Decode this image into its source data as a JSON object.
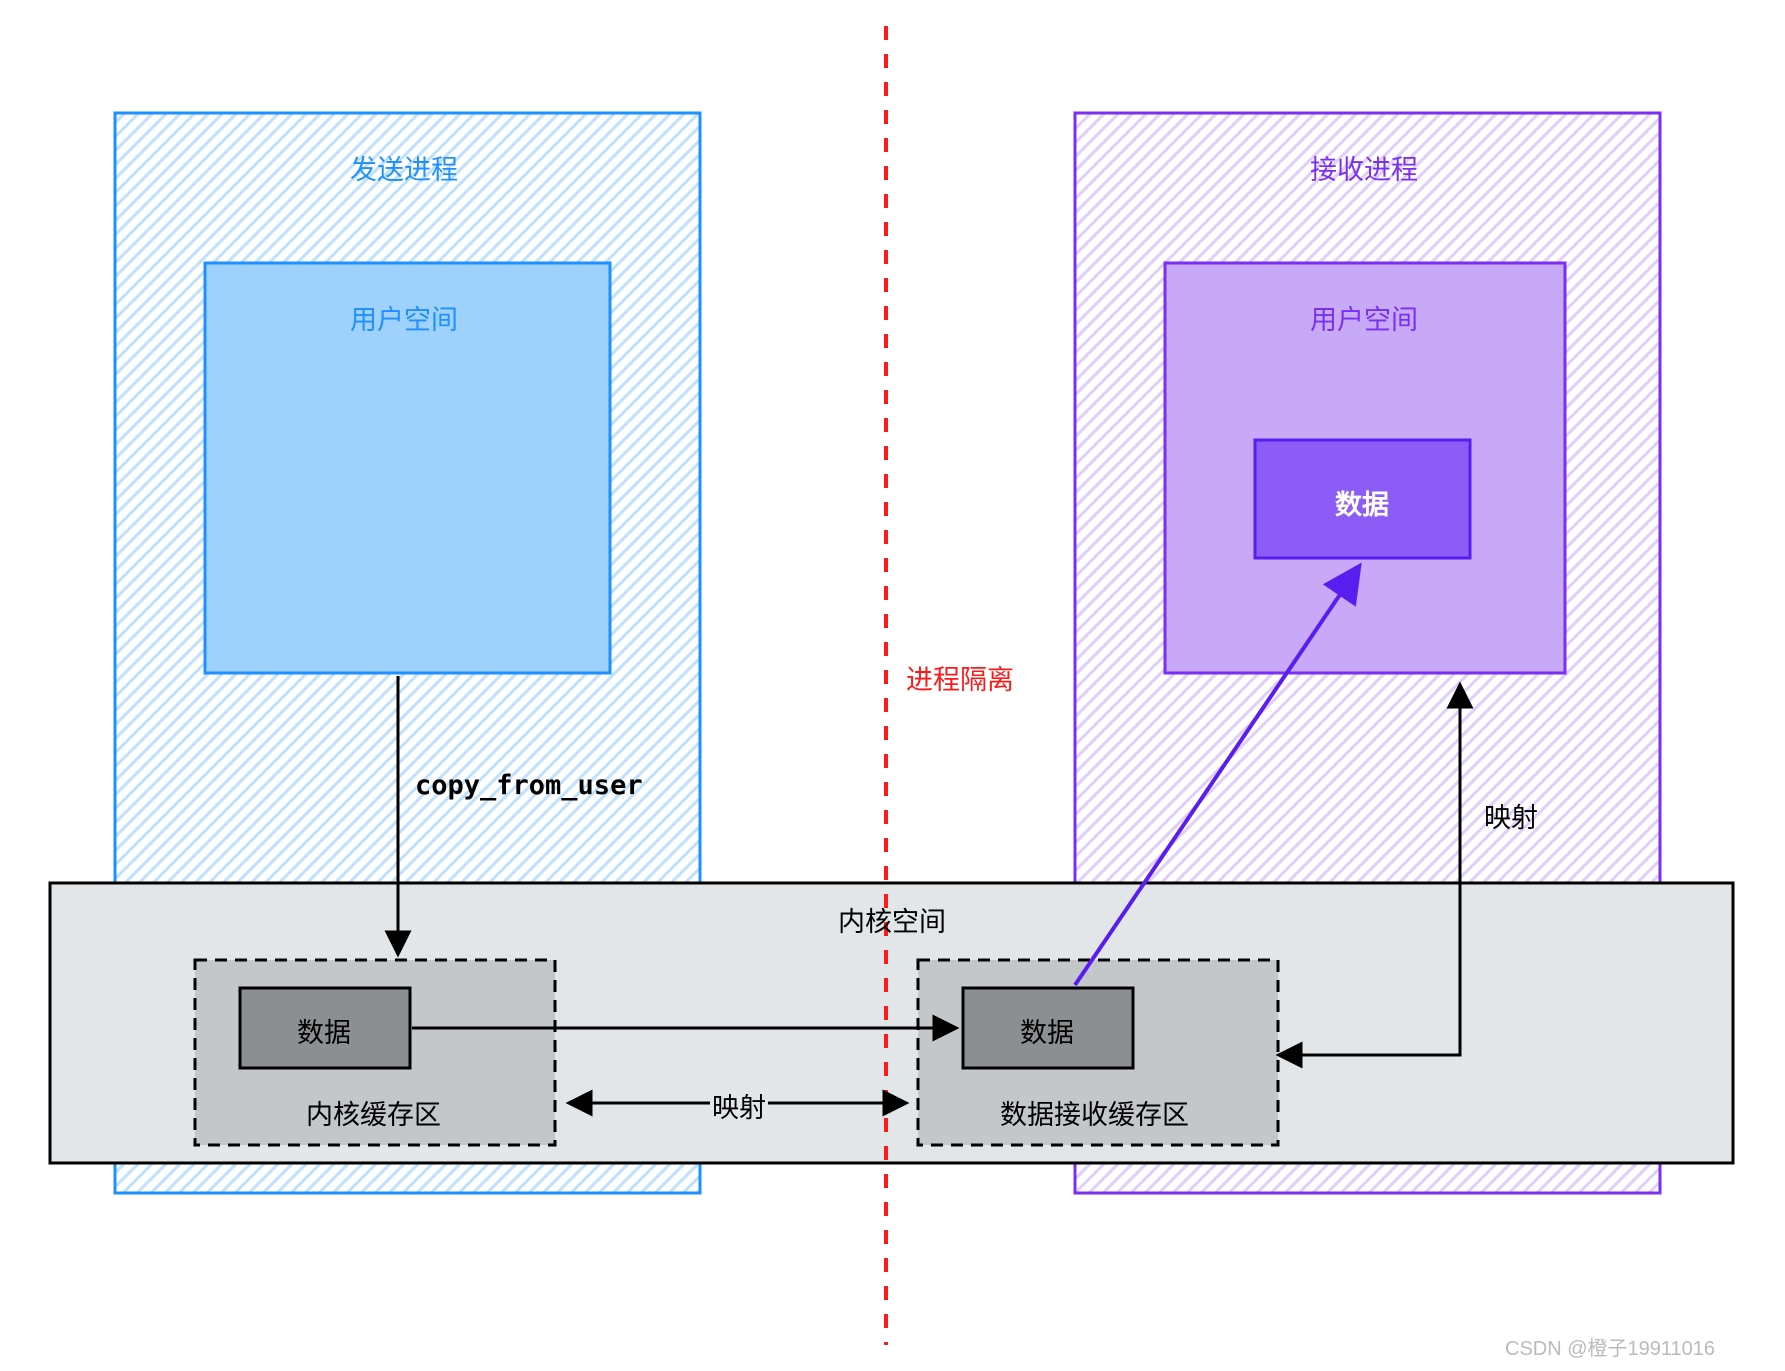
{
  "sender": {
    "title": "发送进程",
    "user_space_label": "用户空间"
  },
  "receiver": {
    "title": "接收进程",
    "user_space_label": "用户空间",
    "data_box_label": "数据"
  },
  "kernel": {
    "title": "内核空间",
    "buffer_label": "内核缓存区",
    "buffer_data_label": "数据",
    "recv_buffer_label": "数据接收缓存区",
    "recv_buffer_data_label": "数据"
  },
  "arrows": {
    "copy_from_user": "copy_from_user",
    "mapping_center": "映射",
    "mapping_right": "映射"
  },
  "center_divider_label": "进程隔离",
  "watermark": "CSDN @橙子19911016",
  "colors": {
    "blue_stroke": "#1E90FF",
    "blue_fill_light": "#e6f3ff",
    "blue_fill_mid": "#9ed1fb",
    "purple_stroke": "#7B2FF2",
    "purple_fill_light": "#f4edff",
    "purple_fill_mid": "#c7a9f7",
    "purple_dark": "#6a3cf5",
    "red": "#ff1a1a",
    "kernel_fill": "#e3e6e8",
    "kernel_box_fill": "#c4c7ca",
    "kernel_data_fill": "#8c8f91"
  }
}
